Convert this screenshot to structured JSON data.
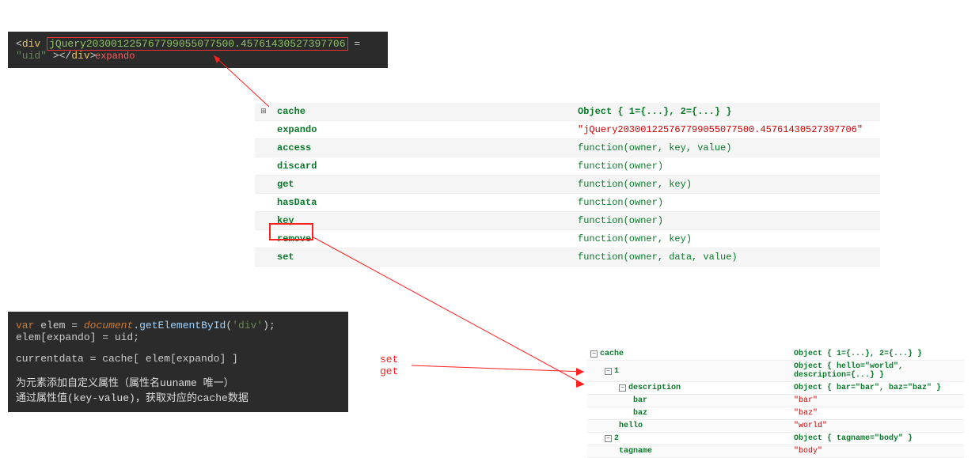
{
  "top_code": {
    "tag": "div",
    "expando_attr": "jQuery203001225767799055077500.45761430527397706",
    "attr_value": "\"uid\"",
    "close_tag": "div",
    "label": "expando"
  },
  "props": {
    "rows": [
      {
        "icon": "⊞",
        "name": "cache",
        "val_html": "obj",
        "val": "Object { 1={...}, 2={...} }"
      },
      {
        "icon": "",
        "name": "expando",
        "val_html": "red",
        "val": "\"jQuery203001225767799055077500.45761430527397706\""
      },
      {
        "icon": "",
        "name": "access",
        "val_html": "fn",
        "val": "function(owner, key, value)"
      },
      {
        "icon": "",
        "name": "discard",
        "val_html": "fn",
        "val": "function(owner)"
      },
      {
        "icon": "",
        "name": "get",
        "val_html": "fn",
        "val": "function(owner, key)"
      },
      {
        "icon": "",
        "name": "hasData",
        "val_html": "fn",
        "val": "function(owner)"
      },
      {
        "icon": "",
        "name": "key",
        "val_html": "fn",
        "val": "function(owner)"
      },
      {
        "icon": "",
        "name": "remove",
        "val_html": "fn",
        "val": "function(owner, key)"
      },
      {
        "icon": "",
        "name": "set",
        "val_html": "fn",
        "val": "function(owner, data, value)"
      }
    ]
  },
  "setget": {
    "line1": "set",
    "line2": "get"
  },
  "bottom_code": {
    "line1_var": "var",
    "line1_elem": "elem",
    "line1_eq": "=",
    "line1_doc": "document",
    "line1_method": ".getElementById",
    "line1_arg": "'div'",
    "line2": "elem[expando] = uid;",
    "line3": "currentdata = cache[ elem[expando] ]",
    "line4": "为元素添加自定义属性（属性名uuname 唯一）",
    "line5": "通过属性值(key-value)，获取对应的cache数据"
  },
  "tree": {
    "rows": [
      {
        "indent": 0,
        "toggle": "−",
        "name": "cache",
        "val": "Object { 1={...}, 2={...} }",
        "vtype": "obj"
      },
      {
        "indent": 1,
        "toggle": "−",
        "name": "1",
        "val": "Object { hello=\"world\", description={...} }",
        "vtype": "obj"
      },
      {
        "indent": 2,
        "toggle": "−",
        "name": "description",
        "val": "Object { bar=\"bar\", baz=\"baz\" }",
        "vtype": "obj"
      },
      {
        "indent": 3,
        "toggle": "",
        "name": "bar",
        "val": "\"bar\"",
        "vtype": "str"
      },
      {
        "indent": 3,
        "toggle": "",
        "name": "baz",
        "val": "\"baz\"",
        "vtype": "str"
      },
      {
        "indent": 2,
        "toggle": "",
        "name": "hello",
        "val": "\"world\"",
        "vtype": "str"
      },
      {
        "indent": 1,
        "toggle": "−",
        "name": "2",
        "val": "Object { tagname=\"body\" }",
        "vtype": "obj"
      },
      {
        "indent": 2,
        "toggle": "",
        "name": "tagname",
        "val": "\"body\"",
        "vtype": "str"
      }
    ]
  }
}
